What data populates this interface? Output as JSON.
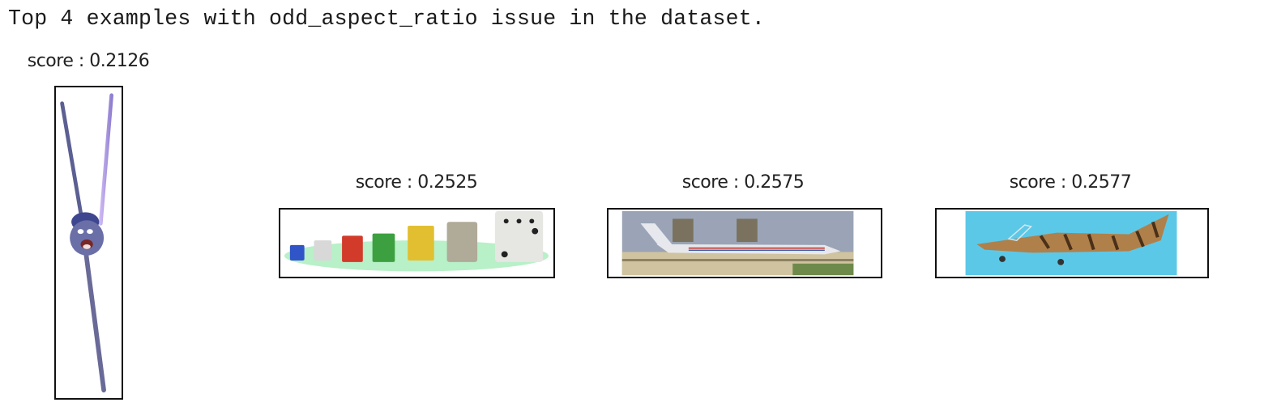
{
  "heading": "Top 4 examples with odd_aspect_ratio issue in the dataset.",
  "issue_type": "odd_aspect_ratio",
  "examples": [
    {
      "score_label": "score : 0.2126",
      "score": 0.2126,
      "image_subject": "cartoon character drinking straw"
    },
    {
      "score_label": "score : 0.2525",
      "score": 0.2525,
      "image_subject": "row of colorful dice"
    },
    {
      "score_label": "score : 0.2575",
      "score": 0.2575,
      "image_subject": "passenger airliner on runway"
    },
    {
      "score_label": "score : 0.2577",
      "score": 0.2577,
      "image_subject": "tiger-striped fighter jet model"
    }
  ]
}
